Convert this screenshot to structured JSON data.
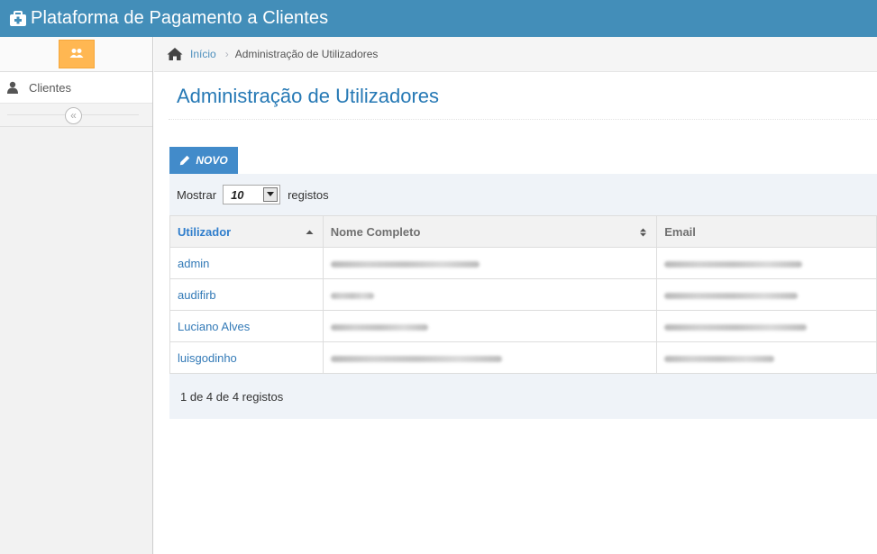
{
  "app": {
    "title": "Plataforma de Pagamento a Clientes",
    "brand_icon": "medkit-icon"
  },
  "colors": {
    "navbar": "#438eb9",
    "shortcut": "#ffb752",
    "title": "#2679b5",
    "button": "#428bca",
    "link": "#337ab7"
  },
  "sidebar": {
    "shortcut_icon": "users-icon",
    "items": [
      {
        "label": "Clientes",
        "icon": "user-icon"
      }
    ],
    "collapse_glyph": "«"
  },
  "breadcrumb": {
    "home_label": "Início",
    "separator": "›",
    "current": "Administração de Utilizadores"
  },
  "page": {
    "title": "Administração de Utilizadores"
  },
  "toolbar": {
    "new_label": "NOVO",
    "show_label": "Mostrar",
    "page_size": "10",
    "records_label": "registos"
  },
  "table": {
    "columns": [
      {
        "label": "Utilizador",
        "sort": "ascending"
      },
      {
        "label": "Nome Completo",
        "sort": "both"
      },
      {
        "label": "Email",
        "sort": "none"
      }
    ],
    "rows": [
      {
        "user": "admin"
      },
      {
        "user": "audifirb"
      },
      {
        "user": "Luciano Alves"
      },
      {
        "user": "luisgodinho"
      }
    ]
  },
  "footer": {
    "info": "1 de 4 de 4 registos"
  }
}
